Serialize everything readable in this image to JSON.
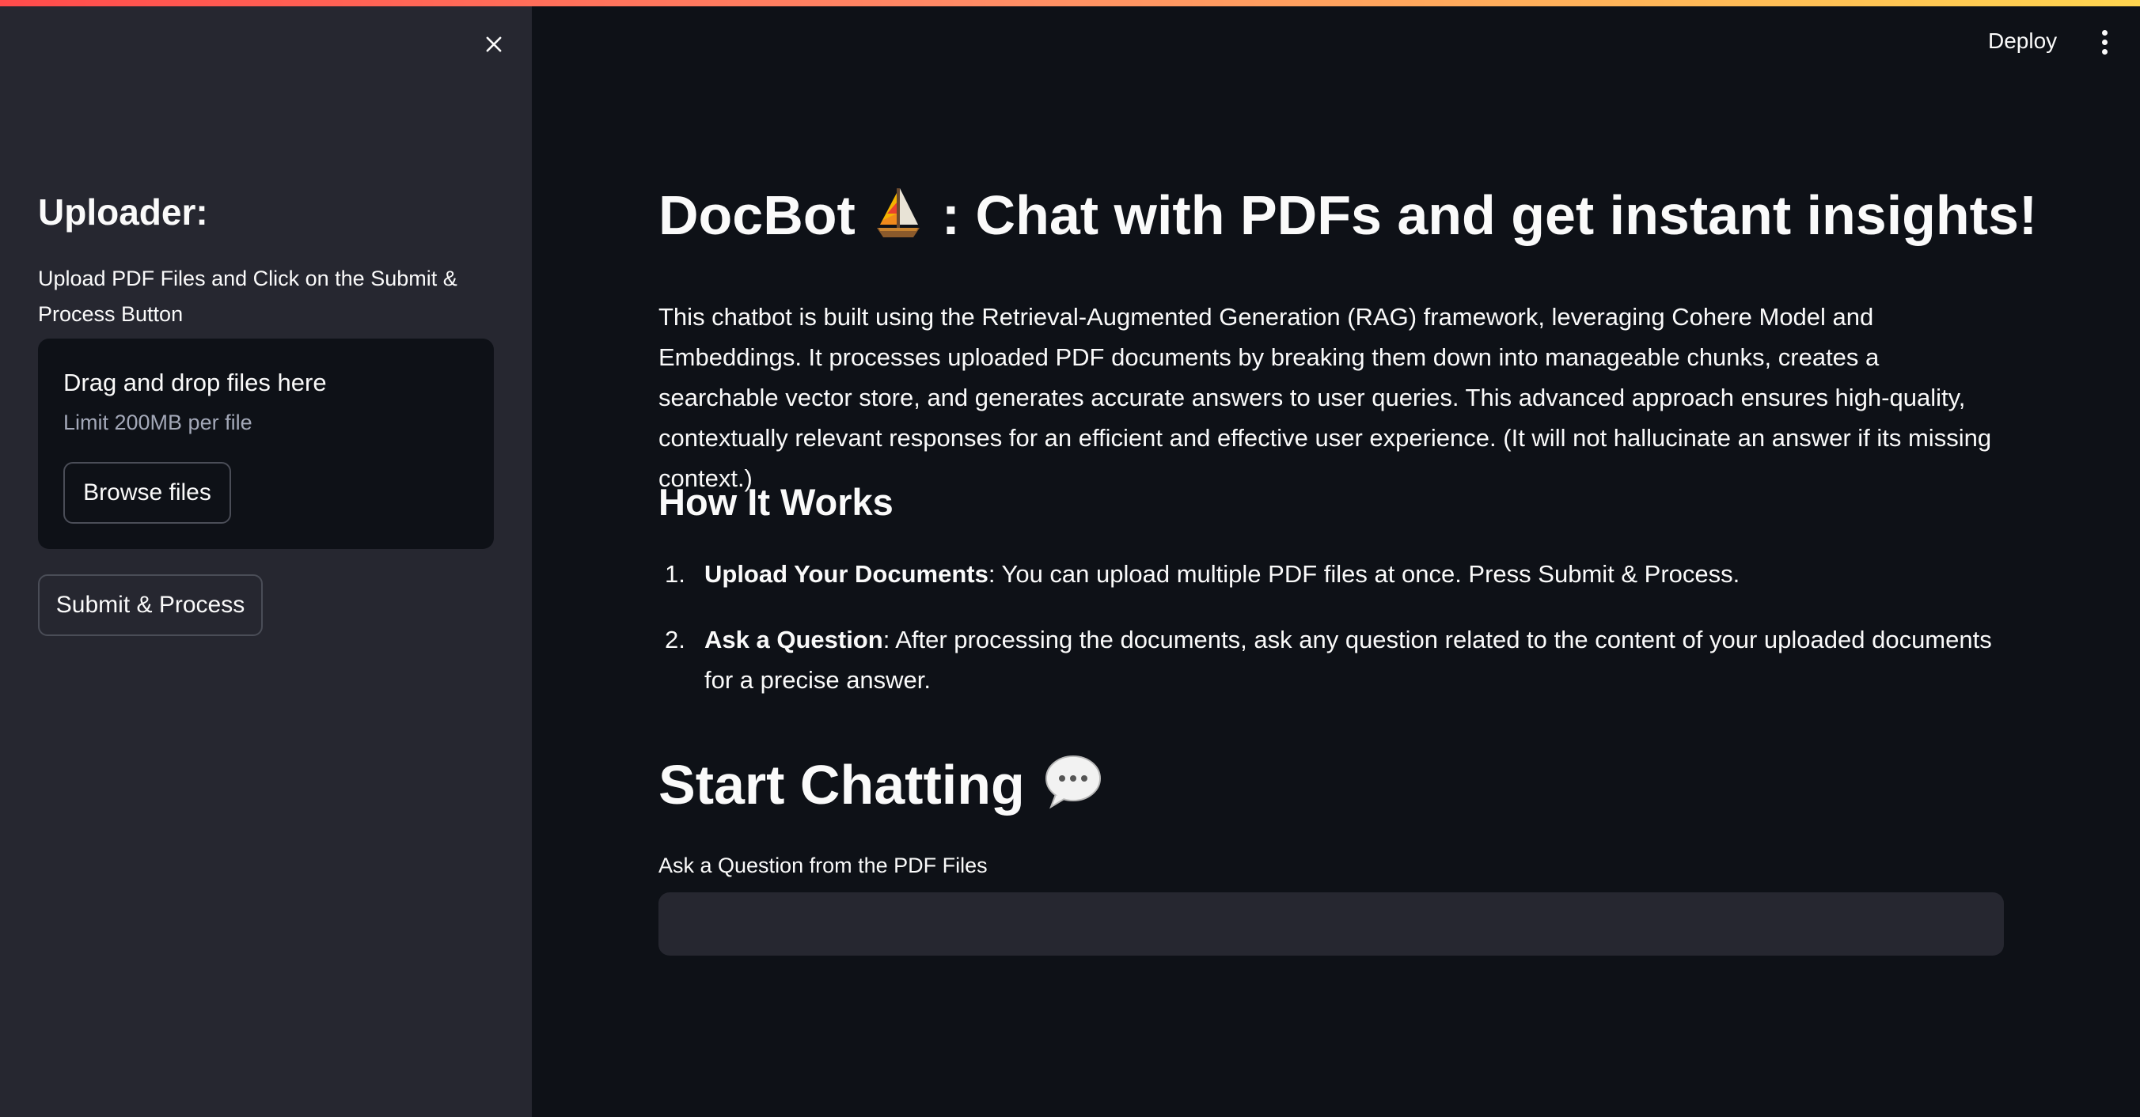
{
  "sidebar": {
    "heading": "Uploader:",
    "instructions": "Upload PDF Files and Click on the Submit & Process Button",
    "dropzone": {
      "title": "Drag and drop files here",
      "limit": "Limit 200MB per file",
      "browse_label": "Browse files"
    },
    "submit_label": "Submit & Process",
    "close_icon": "close-icon"
  },
  "header": {
    "deploy_label": "Deploy",
    "menu_icon": "vertical-ellipsis-icon"
  },
  "main": {
    "title_prefix": "DocBot",
    "title_emoji": "sailboat",
    "title_suffix": ": Chat with PDFs and get instant insights!",
    "intro": "This chatbot is built using the Retrieval-Augmented Generation (RAG) framework, leveraging Cohere Model and Embeddings. It processes uploaded PDF documents by breaking them down into manageable chunks, creates a searchable vector store, and generates accurate answers to user queries. This advanced approach ensures high-quality, contextually relevant responses for an efficient and effective user experience. (It will not hallucinate an answer if its missing context.)",
    "how_heading": "How It Works",
    "steps": [
      {
        "number": "1.",
        "title": "Upload Your Documents",
        "text": ": You can upload multiple PDF files at once. Press Submit & Process."
      },
      {
        "number": "2.",
        "title": "Ask a Question",
        "text": ": After processing the documents, ask any question related to the content of your uploaded documents for a precise answer."
      }
    ],
    "chat_heading": "Start Chatting",
    "chat_emoji": "speech-bubble",
    "question_label": "Ask a Question from the PDF Files",
    "question_value": ""
  },
  "colors": {
    "background": "#0e1117",
    "sidebar": "#262730",
    "input": "#262730",
    "text": "#fafafa",
    "muted_text": "#a3a8b8",
    "accent_gradient_start": "#ff4b4b",
    "accent_gradient_end": "#ffd54f"
  }
}
